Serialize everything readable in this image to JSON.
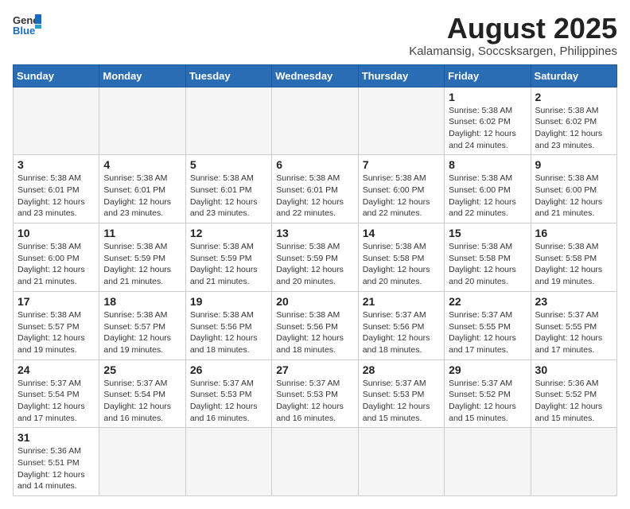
{
  "header": {
    "logo_general": "General",
    "logo_blue": "Blue",
    "month_year": "August 2025",
    "location": "Kalamansig, Soccsksargen, Philippines"
  },
  "weekdays": [
    "Sunday",
    "Monday",
    "Tuesday",
    "Wednesday",
    "Thursday",
    "Friday",
    "Saturday"
  ],
  "weeks": [
    [
      {
        "day": "",
        "info": ""
      },
      {
        "day": "",
        "info": ""
      },
      {
        "day": "",
        "info": ""
      },
      {
        "day": "",
        "info": ""
      },
      {
        "day": "",
        "info": ""
      },
      {
        "day": "1",
        "info": "Sunrise: 5:38 AM\nSunset: 6:02 PM\nDaylight: 12 hours and 24 minutes."
      },
      {
        "day": "2",
        "info": "Sunrise: 5:38 AM\nSunset: 6:02 PM\nDaylight: 12 hours and 23 minutes."
      }
    ],
    [
      {
        "day": "3",
        "info": "Sunrise: 5:38 AM\nSunset: 6:01 PM\nDaylight: 12 hours and 23 minutes."
      },
      {
        "day": "4",
        "info": "Sunrise: 5:38 AM\nSunset: 6:01 PM\nDaylight: 12 hours and 23 minutes."
      },
      {
        "day": "5",
        "info": "Sunrise: 5:38 AM\nSunset: 6:01 PM\nDaylight: 12 hours and 23 minutes."
      },
      {
        "day": "6",
        "info": "Sunrise: 5:38 AM\nSunset: 6:01 PM\nDaylight: 12 hours and 22 minutes."
      },
      {
        "day": "7",
        "info": "Sunrise: 5:38 AM\nSunset: 6:00 PM\nDaylight: 12 hours and 22 minutes."
      },
      {
        "day": "8",
        "info": "Sunrise: 5:38 AM\nSunset: 6:00 PM\nDaylight: 12 hours and 22 minutes."
      },
      {
        "day": "9",
        "info": "Sunrise: 5:38 AM\nSunset: 6:00 PM\nDaylight: 12 hours and 21 minutes."
      }
    ],
    [
      {
        "day": "10",
        "info": "Sunrise: 5:38 AM\nSunset: 6:00 PM\nDaylight: 12 hours and 21 minutes."
      },
      {
        "day": "11",
        "info": "Sunrise: 5:38 AM\nSunset: 5:59 PM\nDaylight: 12 hours and 21 minutes."
      },
      {
        "day": "12",
        "info": "Sunrise: 5:38 AM\nSunset: 5:59 PM\nDaylight: 12 hours and 21 minutes."
      },
      {
        "day": "13",
        "info": "Sunrise: 5:38 AM\nSunset: 5:59 PM\nDaylight: 12 hours and 20 minutes."
      },
      {
        "day": "14",
        "info": "Sunrise: 5:38 AM\nSunset: 5:58 PM\nDaylight: 12 hours and 20 minutes."
      },
      {
        "day": "15",
        "info": "Sunrise: 5:38 AM\nSunset: 5:58 PM\nDaylight: 12 hours and 20 minutes."
      },
      {
        "day": "16",
        "info": "Sunrise: 5:38 AM\nSunset: 5:58 PM\nDaylight: 12 hours and 19 minutes."
      }
    ],
    [
      {
        "day": "17",
        "info": "Sunrise: 5:38 AM\nSunset: 5:57 PM\nDaylight: 12 hours and 19 minutes."
      },
      {
        "day": "18",
        "info": "Sunrise: 5:38 AM\nSunset: 5:57 PM\nDaylight: 12 hours and 19 minutes."
      },
      {
        "day": "19",
        "info": "Sunrise: 5:38 AM\nSunset: 5:56 PM\nDaylight: 12 hours and 18 minutes."
      },
      {
        "day": "20",
        "info": "Sunrise: 5:38 AM\nSunset: 5:56 PM\nDaylight: 12 hours and 18 minutes."
      },
      {
        "day": "21",
        "info": "Sunrise: 5:37 AM\nSunset: 5:56 PM\nDaylight: 12 hours and 18 minutes."
      },
      {
        "day": "22",
        "info": "Sunrise: 5:37 AM\nSunset: 5:55 PM\nDaylight: 12 hours and 17 minutes."
      },
      {
        "day": "23",
        "info": "Sunrise: 5:37 AM\nSunset: 5:55 PM\nDaylight: 12 hours and 17 minutes."
      }
    ],
    [
      {
        "day": "24",
        "info": "Sunrise: 5:37 AM\nSunset: 5:54 PM\nDaylight: 12 hours and 17 minutes."
      },
      {
        "day": "25",
        "info": "Sunrise: 5:37 AM\nSunset: 5:54 PM\nDaylight: 12 hours and 16 minutes."
      },
      {
        "day": "26",
        "info": "Sunrise: 5:37 AM\nSunset: 5:53 PM\nDaylight: 12 hours and 16 minutes."
      },
      {
        "day": "27",
        "info": "Sunrise: 5:37 AM\nSunset: 5:53 PM\nDaylight: 12 hours and 16 minutes."
      },
      {
        "day": "28",
        "info": "Sunrise: 5:37 AM\nSunset: 5:53 PM\nDaylight: 12 hours and 15 minutes."
      },
      {
        "day": "29",
        "info": "Sunrise: 5:37 AM\nSunset: 5:52 PM\nDaylight: 12 hours and 15 minutes."
      },
      {
        "day": "30",
        "info": "Sunrise: 5:36 AM\nSunset: 5:52 PM\nDaylight: 12 hours and 15 minutes."
      }
    ],
    [
      {
        "day": "31",
        "info": "Sunrise: 5:36 AM\nSunset: 5:51 PM\nDaylight: 12 hours and 14 minutes."
      },
      {
        "day": "",
        "info": ""
      },
      {
        "day": "",
        "info": ""
      },
      {
        "day": "",
        "info": ""
      },
      {
        "day": "",
        "info": ""
      },
      {
        "day": "",
        "info": ""
      },
      {
        "day": "",
        "info": ""
      }
    ]
  ]
}
